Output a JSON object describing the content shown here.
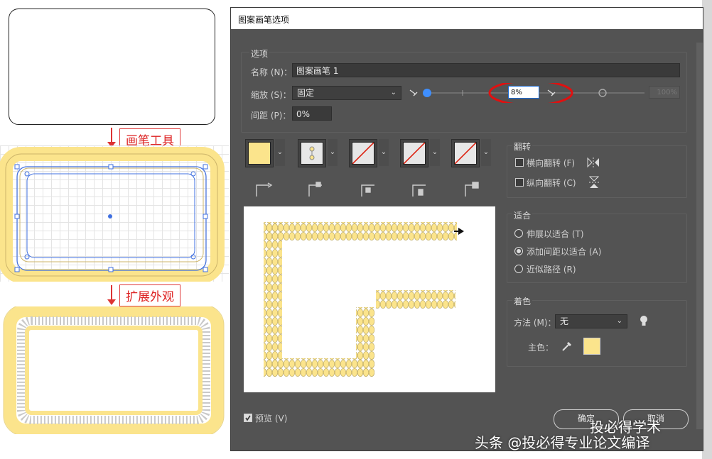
{
  "annotations": {
    "step1": "画笔工具",
    "step2": "扩展外观"
  },
  "dialog": {
    "title": "图案画笔选项",
    "options_section": "选项",
    "name_label": "名称 (N)：",
    "name_value": "图案画笔 1",
    "scale_label": "缩放 (S)：",
    "scale_value": "固定",
    "scale_min": "8%",
    "scale_max": "100%",
    "spacing_label": "间距 (P)：",
    "spacing_value": "0%",
    "flip_section": "翻转",
    "flip_horizontal": "横向翻转 (F)",
    "flip_vertical": "纵向翻转 (C)",
    "fit_section": "适合",
    "fit_stretch": "伸展以适合 (T)",
    "fit_add_space": "添加间距以适合 (A)",
    "fit_approx": "近似路径 (R)",
    "color_section": "着色",
    "method_label": "方法 (M)：",
    "method_value": "无",
    "key_color_label": "主色：",
    "key_color": "#fbe48c",
    "preview_label": "预览 (V)",
    "ok_label": "确定",
    "cancel_label": "取消"
  },
  "watermark": {
    "line1": "投必得学术",
    "line2": "头条 @投必得专业论文编译"
  },
  "colors": {
    "dialog_bg": "#535353",
    "pattern_fill": "#fbe48c",
    "highlight_ring": "#e01010"
  }
}
